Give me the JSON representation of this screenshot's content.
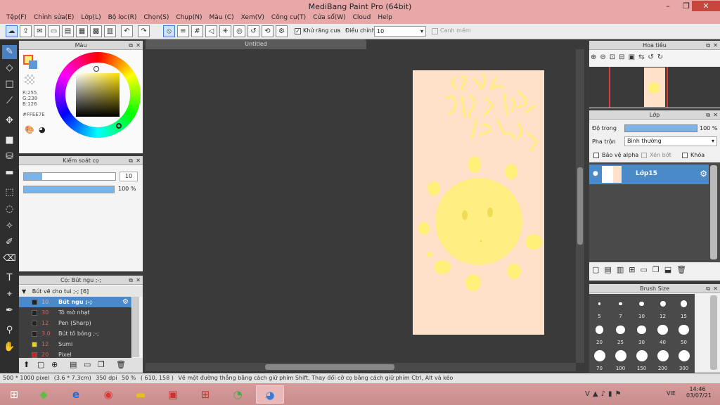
{
  "window": {
    "title": "MediBang Paint Pro (64bit)"
  },
  "menu": [
    "Tệp(F)",
    "Chỉnh sửa(E)",
    "Lớp(L)",
    "Bộ lọc(R)",
    "Chọn(S)",
    "Chụp(N)",
    "Màu (C)",
    "Xem(V)",
    "Công cụ(T)",
    "Cửa sổ(W)",
    "Cloud",
    "Help"
  ],
  "toolbar": {
    "antialias_label": "Khử răng cưa",
    "correction_label": "Điều chỉnh",
    "correction_value": "10",
    "snap_label": "Canh mềm"
  },
  "color_panel": {
    "title": "Màu",
    "r": "R:255",
    "g": "G:238",
    "b": "B:126",
    "hex": "#FFEE7E",
    "primary_color": "#ffee7e"
  },
  "brush_control": {
    "title": "Kiểm soát cọ",
    "size_value": "10",
    "opacity_value": "100 %"
  },
  "brush_list": {
    "title": "Cọ: Bút ngu ;-;",
    "group": "Bút vẽ cho tui ;-; [6]",
    "items": [
      {
        "size": "10",
        "name": "Bút ngu ;-;",
        "color": "#222222",
        "selected": true
      },
      {
        "size": "30",
        "name": "Tô mờ nhạt",
        "color": "#222222",
        "selected": false
      },
      {
        "size": "12",
        "name": "Pen (Sharp)",
        "color": "#222222",
        "selected": false
      },
      {
        "size": "3.0",
        "name": "Bút tô bóng ;-;",
        "color": "#222222",
        "selected": false
      },
      {
        "size": "12",
        "name": "Sumi",
        "color": "#e8d020",
        "selected": false
      },
      {
        "size": "20",
        "name": "Pixel",
        "color": "#d02020",
        "selected": false
      }
    ]
  },
  "canvas": {
    "tab": "Untitled"
  },
  "navigator": {
    "title": "Hoa tiêu"
  },
  "layers": {
    "title": "Lớp",
    "opacity_label": "Độ trong",
    "opacity_value": "100 %",
    "blend_label": "Pha trộn",
    "blend_value": "Bình thường",
    "protect_alpha": "Bảo vệ alpha",
    "clipping": "Xén bớt",
    "lock": "Khóa",
    "items": [
      {
        "name": "Lớp15"
      }
    ]
  },
  "brush_size": {
    "title": "Brush Size",
    "sizes": [
      "5",
      "7",
      "10",
      "12",
      "15",
      "20",
      "25",
      "30",
      "40",
      "50",
      "70",
      "100",
      "150",
      "200",
      "300"
    ]
  },
  "status": {
    "dimensions": "500 * 1000 pixel",
    "physical": "(3.6 * 7.3cm)",
    "dpi": "350 dpi",
    "zoom": "50 %",
    "coords": "( 610, 158 )",
    "hint": "Vẽ một đường thẳng bằng cách giữ phím Shift, Thay đổi cỡ cọ bằng cách giữ phím Ctrl, Alt và kéo"
  },
  "taskbar": {
    "lang": "VIE",
    "time": "14:46",
    "date": "03/07/21"
  }
}
